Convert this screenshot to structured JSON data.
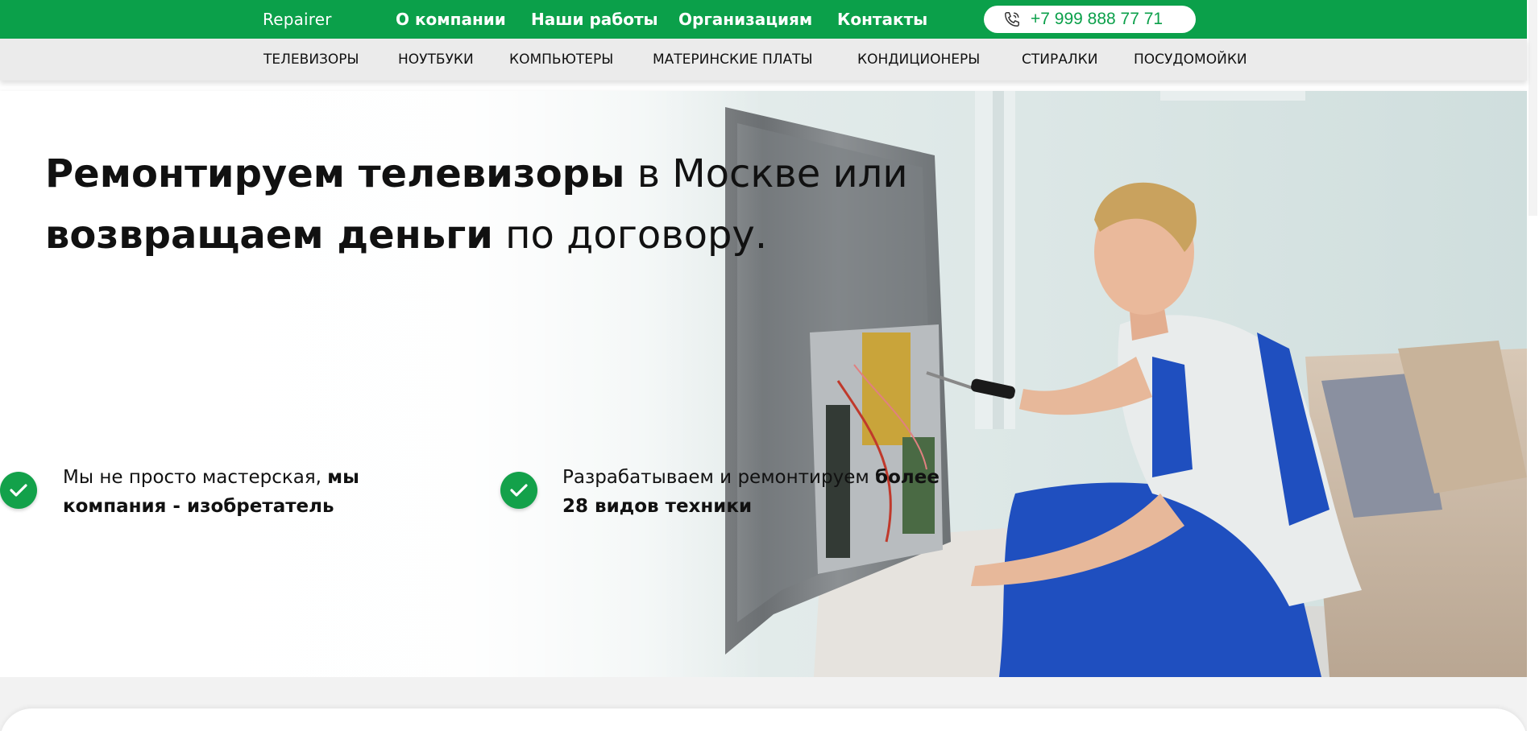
{
  "header": {
    "logo": "Repairer",
    "nav": [
      {
        "label": "О компании"
      },
      {
        "label": "Наши работы"
      },
      {
        "label": "Организациям"
      },
      {
        "label": "Контакты"
      }
    ],
    "phone": "+7 999 888 77 71",
    "phone_icon": "phone-icon"
  },
  "categories": [
    {
      "label": "ТЕЛЕВИЗОРЫ"
    },
    {
      "label": "НОУТБУКИ"
    },
    {
      "label": "КОМПЬЮТЕРЫ"
    },
    {
      "label": "МАТЕРИНСКИЕ ПЛАТЫ"
    },
    {
      "label": "КОНДИЦИОНЕРЫ"
    },
    {
      "label": "СТИРАЛКИ"
    },
    {
      "label": "ПОСУДОМОЙКИ"
    }
  ],
  "hero": {
    "headline": {
      "line1_bold": "Ремонтируем телевизоры",
      "line1_light": " в Москве или",
      "line2_bold": "возвращаем деньги",
      "line2_light": " по договору."
    },
    "features": [
      {
        "line1_regular": "Мы не просто мастерская, ",
        "line1_bold": "мы",
        "line2_bold": "компания - изобретатель",
        "icon": "check-circle-icon"
      },
      {
        "line1_regular": "Разрабатываем и ремонтируем ",
        "line1_bold": "более",
        "line2_bold": "28 видов техники",
        "icon": "check-circle-icon"
      }
    ],
    "image": "technician-repairing-tv-photo"
  },
  "colors": {
    "brand_green": "#0ba04a",
    "category_bar": "#ebebeb",
    "text": "#111111"
  }
}
